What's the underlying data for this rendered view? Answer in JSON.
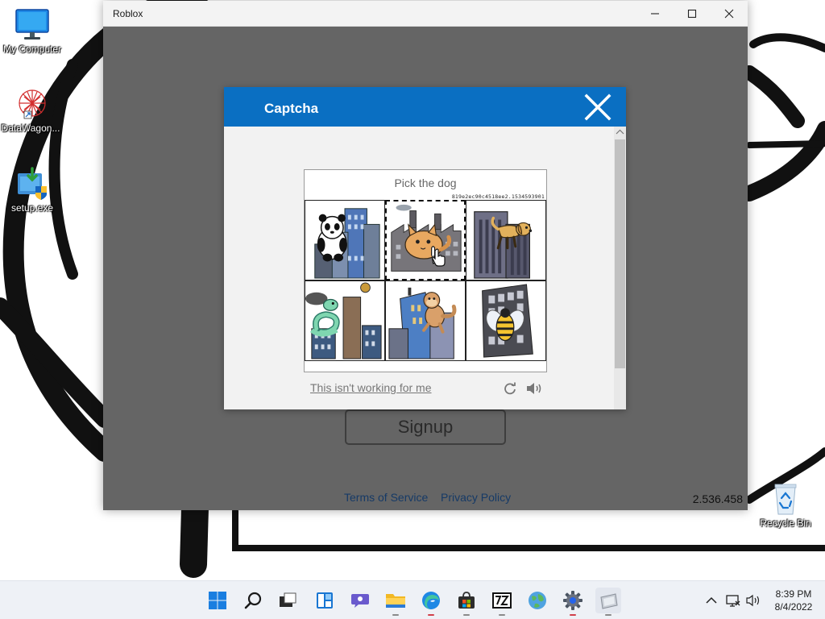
{
  "desktop": {
    "icons": [
      {
        "label": "My Computer",
        "icon": "monitor-icon"
      },
      {
        "label": "DataWagon...",
        "icon": "datawagon-icon"
      },
      {
        "label": "setup.exe",
        "icon": "installer-icon"
      },
      {
        "label": "Recycle Bin",
        "icon": "recycle-bin-icon"
      }
    ]
  },
  "window": {
    "title": "Roblox",
    "minimize_icon": "minimize-icon",
    "maximize_icon": "maximize-icon",
    "close_icon": "close-icon",
    "signup_label": "Signup",
    "terms_label": "Terms of Service",
    "privacy_label": "Privacy Policy",
    "version": "2.536.458",
    "background_color": "#656565"
  },
  "captcha": {
    "title": "Captcha",
    "header_color": "#0a6fc2",
    "prompt": "Pick the dog",
    "challenge_id": "819e2ec90c4518ee2.1534593901",
    "tiles": [
      {
        "subject": "panda",
        "selected": false
      },
      {
        "subject": "cat",
        "selected": true
      },
      {
        "subject": "dog",
        "selected": false
      },
      {
        "subject": "snake",
        "selected": false
      },
      {
        "subject": "monkey",
        "selected": false
      },
      {
        "subject": "bee",
        "selected": false
      }
    ],
    "help_link": "This isn't working for me",
    "refresh_icon": "refresh-icon",
    "audio_icon": "audio-icon"
  },
  "taskbar": {
    "apps": [
      {
        "name": "start-button",
        "icon": "windows-icon"
      },
      {
        "name": "search",
        "icon": "search-icon"
      },
      {
        "name": "task-view",
        "icon": "task-view-icon"
      },
      {
        "name": "widgets",
        "icon": "widgets-icon"
      },
      {
        "name": "chat",
        "icon": "chat-icon"
      },
      {
        "name": "file-explorer",
        "icon": "folder-icon"
      },
      {
        "name": "edge",
        "icon": "edge-icon"
      },
      {
        "name": "store",
        "icon": "store-icon"
      },
      {
        "name": "7zip",
        "icon": "7zip-icon"
      },
      {
        "name": "globe-app",
        "icon": "globe-icon"
      },
      {
        "name": "settings",
        "icon": "gear-icon"
      },
      {
        "name": "roblox-app",
        "icon": "app-window-icon"
      }
    ],
    "tray": {
      "chevron_icon": "chevron-up-icon",
      "network_icon": "network-icon",
      "volume_icon": "volume-icon"
    },
    "time": "8:39 PM",
    "date": "8/4/2022"
  }
}
